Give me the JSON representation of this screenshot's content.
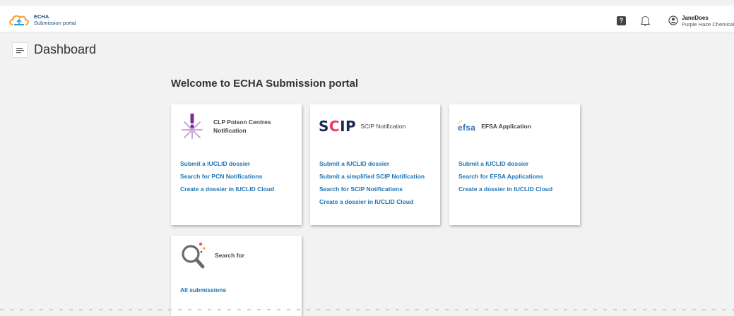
{
  "header": {
    "logo_line1": "ECHA",
    "logo_line2": "Submission portal",
    "help_label": "?",
    "user": {
      "name": "JaneDoes",
      "org": "Purple Haze Chemical"
    }
  },
  "page": {
    "title": "Dashboard",
    "welcome": "Welcome to ECHA Submission portal"
  },
  "cards": [
    {
      "title_line1": "CLP Poison Centres",
      "title_line2": "Notification",
      "icon": "pcn-star-icon",
      "links": [
        "Submit a IUCLID dossier",
        "Search for PCN Notifications",
        "Create a dossier in IUCLID Cloud"
      ]
    },
    {
      "logo_text_s": "S",
      "logo_text_c": "C",
      "logo_text_ip": "IP",
      "title": "SCIP Notification",
      "links": [
        "Submit a IUCLID dossier",
        "Submit a simplified SCIP Notification",
        "Search for SCIP Notifications",
        "Create a dossier in IUCLID Cloud"
      ]
    },
    {
      "logo_text": "efsa",
      "title": "EFSA Application",
      "links": [
        "Submit a IUCLID dossier",
        "Search for EFSA Applications",
        "Create a dossier in IUCLID Cloud"
      ]
    },
    {
      "title": "Search for",
      "icon": "magnifier-icon",
      "links": [
        "All submissions"
      ]
    }
  ],
  "colors": {
    "link": "#1a74b5",
    "background": "#f2f2f2",
    "scip_red": "#e83c5e",
    "scip_navy": "#1d2b50",
    "efsa_blue": "#2e6fb7"
  }
}
